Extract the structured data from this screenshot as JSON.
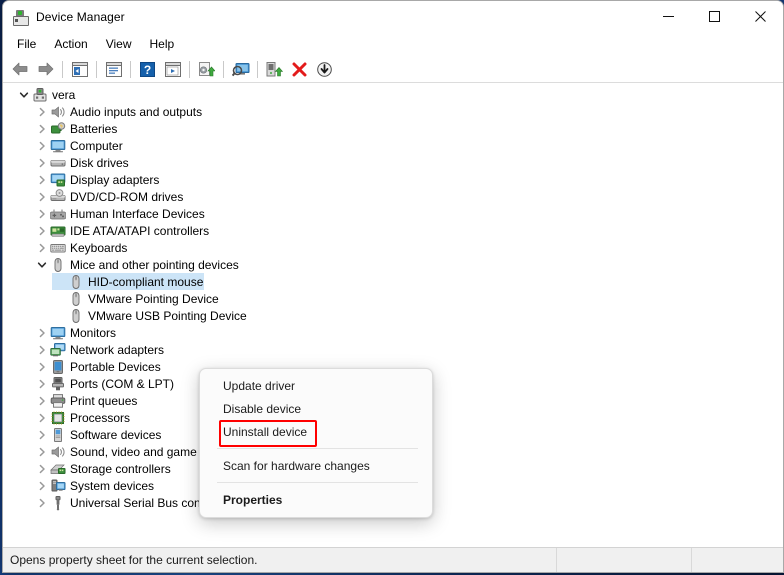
{
  "window": {
    "title": "Device Manager",
    "icon": "device-manager-icon",
    "controls": {
      "minimize": "−",
      "maximize": "□",
      "close": "×"
    }
  },
  "menubar": {
    "items": [
      {
        "label": "File",
        "name": "menu-file"
      },
      {
        "label": "Action",
        "name": "menu-action"
      },
      {
        "label": "View",
        "name": "menu-view"
      },
      {
        "label": "Help",
        "name": "menu-help"
      }
    ]
  },
  "toolbar": {
    "buttons": [
      {
        "name": "back-button",
        "icon": "back-arrow-icon",
        "title": "Back"
      },
      {
        "name": "forward-button",
        "icon": "forward-arrow-icon",
        "title": "Forward"
      },
      {
        "name": "show-hide-console-tree-button",
        "icon": "console-tree-icon",
        "title": "Show/Hide Console Tree"
      },
      {
        "name": "properties-button",
        "icon": "properties-window-icon",
        "title": "Properties"
      },
      {
        "name": "help-button",
        "icon": "question-mark-icon",
        "title": "Help"
      },
      {
        "name": "scan-view-button",
        "icon": "play-window-icon",
        "title": "Scan"
      },
      {
        "name": "update-driver-button",
        "icon": "update-driver-icon",
        "title": "Update Driver Software"
      },
      {
        "name": "scan-hardware-changes-button",
        "icon": "scan-hardware-icon",
        "title": "Scan for hardware changes"
      },
      {
        "name": "enable-device-button",
        "icon": "enable-device-icon",
        "title": "Enable device"
      },
      {
        "name": "uninstall-device-button",
        "icon": "red-x-icon",
        "title": "Uninstall device"
      },
      {
        "name": "disable-device-button",
        "icon": "down-arrow-circle-icon",
        "title": "Disable device"
      }
    ]
  },
  "tree": {
    "root": {
      "label": "vera",
      "icon": "computer-node-icon",
      "expanded": true
    },
    "nodes": [
      {
        "label": "Audio inputs and outputs",
        "icon": "speaker-icon",
        "expanded": false,
        "depth": 1
      },
      {
        "label": "Batteries",
        "icon": "battery-icon",
        "expanded": false,
        "depth": 1
      },
      {
        "label": "Computer",
        "icon": "monitor-icon",
        "expanded": false,
        "depth": 1
      },
      {
        "label": "Disk drives",
        "icon": "disk-drive-icon",
        "expanded": false,
        "depth": 1
      },
      {
        "label": "Display adapters",
        "icon": "display-adapter-icon",
        "expanded": false,
        "depth": 1
      },
      {
        "label": "DVD/CD-ROM drives",
        "icon": "optical-drive-icon",
        "expanded": false,
        "depth": 1
      },
      {
        "label": "Human Interface Devices",
        "icon": "gamepad-icon",
        "expanded": false,
        "depth": 1
      },
      {
        "label": "IDE ATA/ATAPI controllers",
        "icon": "controller-card-icon",
        "expanded": false,
        "depth": 1
      },
      {
        "label": "Keyboards",
        "icon": "keyboard-icon",
        "expanded": false,
        "depth": 1
      },
      {
        "label": "Mice and other pointing devices",
        "icon": "mouse-icon",
        "expanded": true,
        "depth": 1
      },
      {
        "label": "HID-compliant mouse",
        "icon": "mouse-icon",
        "depth": 2,
        "selected": true
      },
      {
        "label": "VMware Pointing Device",
        "icon": "mouse-icon",
        "depth": 2
      },
      {
        "label": "VMware USB Pointing Device",
        "icon": "mouse-icon",
        "depth": 2
      },
      {
        "label": "Monitors",
        "icon": "monitor-icon",
        "expanded": false,
        "depth": 1
      },
      {
        "label": "Network adapters",
        "icon": "network-adapter-icon",
        "expanded": false,
        "depth": 1
      },
      {
        "label": "Portable Devices",
        "icon": "portable-device-icon",
        "expanded": false,
        "depth": 1
      },
      {
        "label": "Ports (COM & LPT)",
        "icon": "port-icon",
        "expanded": false,
        "depth": 1
      },
      {
        "label": "Print queues",
        "icon": "printer-icon",
        "expanded": false,
        "depth": 1
      },
      {
        "label": "Processors",
        "icon": "processor-icon",
        "expanded": false,
        "depth": 1
      },
      {
        "label": "Software devices",
        "icon": "software-device-icon",
        "expanded": false,
        "depth": 1
      },
      {
        "label": "Sound, video and game controllers",
        "icon": "speaker-icon",
        "expanded": false,
        "depth": 1
      },
      {
        "label": "Storage controllers",
        "icon": "storage-controller-icon",
        "expanded": false,
        "depth": 1
      },
      {
        "label": "System devices",
        "icon": "system-device-icon",
        "expanded": false,
        "depth": 1
      },
      {
        "label": "Universal Serial Bus controllers",
        "icon": "usb-icon",
        "expanded": false,
        "depth": 1
      }
    ]
  },
  "context_menu": {
    "items": [
      {
        "label": "Update driver",
        "name": "ctx-update-driver",
        "type": "item"
      },
      {
        "label": "Disable device",
        "name": "ctx-disable-device",
        "type": "item"
      },
      {
        "label": "Uninstall device",
        "name": "ctx-uninstall-device",
        "type": "item",
        "highlighted": true
      },
      {
        "type": "separator"
      },
      {
        "label": "Scan for hardware changes",
        "name": "ctx-scan-hardware-changes",
        "type": "item"
      },
      {
        "type": "separator"
      },
      {
        "label": "Properties",
        "name": "ctx-properties",
        "type": "item",
        "bold": true
      }
    ],
    "highlight_color": "#ff0000"
  },
  "statusbar": {
    "text": "Opens property sheet for the current selection."
  },
  "colors": {
    "selection": "#cce4f7",
    "highlight_box": "#ff0000",
    "window_bg": "#ffffff",
    "statusbar_bg": "#f0f0f0"
  }
}
